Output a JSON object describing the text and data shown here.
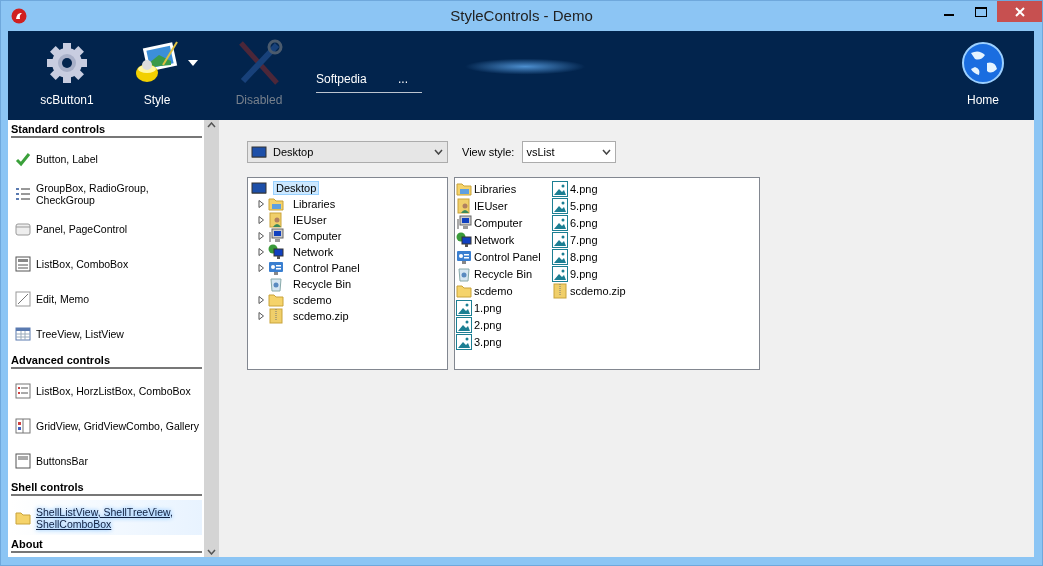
{
  "window": {
    "title": "StyleControls - Demo"
  },
  "toolbar": {
    "buttons": [
      {
        "label": "scButton1",
        "disabled": false,
        "dropdown": false
      },
      {
        "label": "Style",
        "disabled": false,
        "dropdown": true
      },
      {
        "label": "Disabled",
        "disabled": true,
        "dropdown": false
      }
    ],
    "edit": {
      "value": "Softpedia",
      "button": "..."
    },
    "home": {
      "label": "Home",
      "disabled": false,
      "dropdown": false
    }
  },
  "sidebar": {
    "sections": [
      {
        "title": "Standard controls",
        "items": [
          {
            "label": "Button, Label",
            "selected": false
          },
          {
            "label": "GroupBox, RadioGroup, CheckGroup",
            "selected": false
          },
          {
            "label": "Panel, PageControl",
            "selected": false
          },
          {
            "label": "ListBox, ComboBox",
            "selected": false
          },
          {
            "label": "Edit, Memo",
            "selected": false
          },
          {
            "label": "TreeView, ListView",
            "selected": false
          }
        ]
      },
      {
        "title": "Advanced controls",
        "items": [
          {
            "label": "ListBox, HorzListBox, ComboBox",
            "selected": false
          },
          {
            "label": "GridView, GridViewCombo, Gallery",
            "selected": false
          },
          {
            "label": "ButtonsBar",
            "selected": false
          }
        ]
      },
      {
        "title": "Shell controls",
        "items": [
          {
            "label": "ShellListView, ShellTreeView, ShellComboBox",
            "selected": true
          }
        ]
      },
      {
        "title": "About"
      }
    ]
  },
  "shell_combo": {
    "value": "Desktop"
  },
  "view_style": {
    "label": "View style:",
    "value": "vsList"
  },
  "tree": {
    "label": "Desktop",
    "selected": true,
    "children": [
      {
        "label": "Libraries",
        "kind": "libraries",
        "expandable": true
      },
      {
        "label": "IEUser",
        "kind": "user",
        "expandable": true
      },
      {
        "label": "Computer",
        "kind": "computer",
        "expandable": true
      },
      {
        "label": "Network",
        "kind": "network",
        "expandable": true
      },
      {
        "label": "Control Panel",
        "kind": "control-panel",
        "expandable": true
      },
      {
        "label": "Recycle Bin",
        "kind": "recycle",
        "expandable": false
      },
      {
        "label": "scdemo",
        "kind": "folder",
        "expandable": true
      },
      {
        "label": "scdemo.zip",
        "kind": "zip",
        "expandable": true
      }
    ]
  },
  "list": {
    "items": [
      {
        "label": "Libraries",
        "kind": "libraries"
      },
      {
        "label": "IEUser",
        "kind": "user"
      },
      {
        "label": "Computer",
        "kind": "computer"
      },
      {
        "label": "Network",
        "kind": "network"
      },
      {
        "label": "Control Panel",
        "kind": "control-panel"
      },
      {
        "label": "Recycle Bin",
        "kind": "recycle"
      },
      {
        "label": "scdemo",
        "kind": "folder"
      },
      {
        "label": "1.png",
        "kind": "image"
      },
      {
        "label": "2.png",
        "kind": "image"
      },
      {
        "label": "3.png",
        "kind": "image"
      },
      {
        "label": "4.png",
        "kind": "image"
      },
      {
        "label": "5.png",
        "kind": "image"
      },
      {
        "label": "6.png",
        "kind": "image"
      },
      {
        "label": "7.png",
        "kind": "image"
      },
      {
        "label": "8.png",
        "kind": "image"
      },
      {
        "label": "9.png",
        "kind": "image"
      },
      {
        "label": "scdemo.zip",
        "kind": "zip"
      }
    ]
  }
}
